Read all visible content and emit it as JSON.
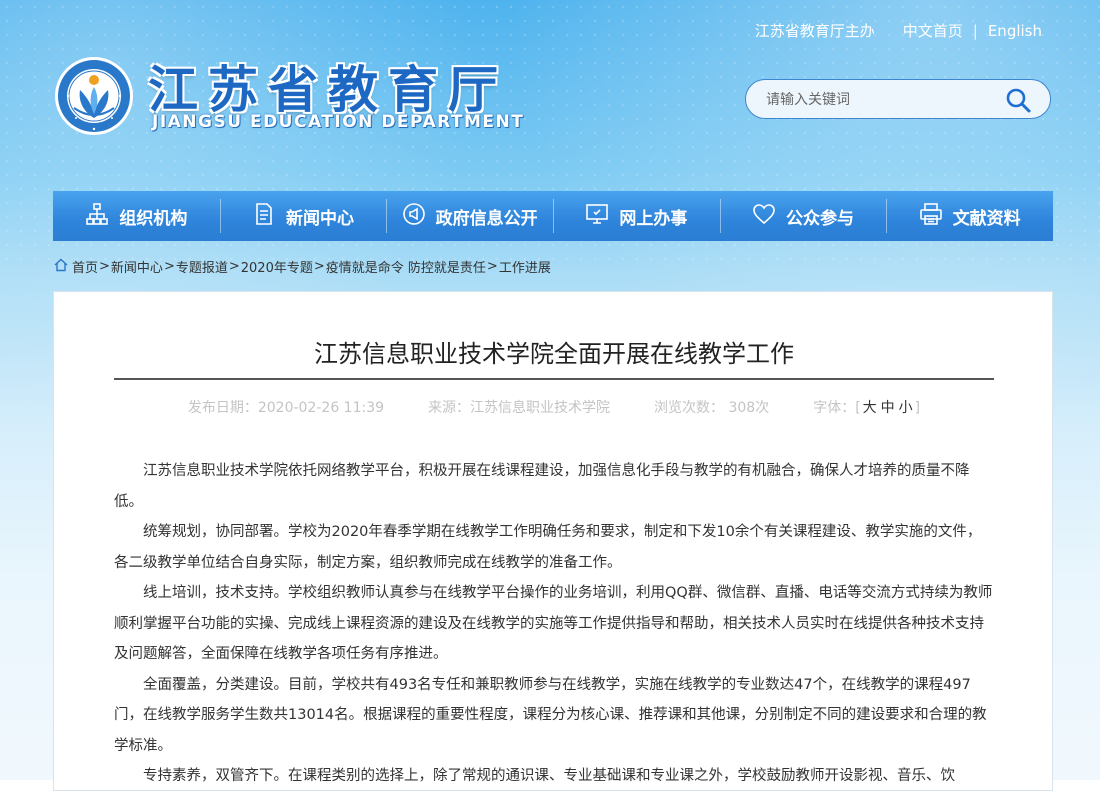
{
  "header": {
    "sponsor": "江苏省教育厅主办",
    "home_link": "中文首页",
    "separator": "|",
    "english_link": "English",
    "logo_cn": "江苏省教育厅",
    "logo_en": "JIANGSU EDUCATION DEPARTMENT"
  },
  "search": {
    "placeholder": "请输入关键词"
  },
  "nav": [
    {
      "label": "组织机构",
      "icon": "org-chart-icon"
    },
    {
      "label": "新闻中心",
      "icon": "document-icon"
    },
    {
      "label": "政府信息公开",
      "icon": "megaphone-icon"
    },
    {
      "label": "网上办事",
      "icon": "monitor-icon"
    },
    {
      "label": "公众参与",
      "icon": "heart-icon"
    },
    {
      "label": "文献资料",
      "icon": "printer-icon"
    }
  ],
  "breadcrumb": [
    "首页",
    "新闻中心",
    "专题报道",
    "2020年专题",
    "疫情就是命令 防控就是责任",
    "工作进展"
  ],
  "article": {
    "title": "江苏信息职业技术学院全面开展在线教学工作",
    "publish_date": "发布日期：2020-02-26 11:39",
    "source": "来源：江苏信息职业技术学院",
    "views": "浏览次数： 308次",
    "font_label": "字体：",
    "font_open": "[",
    "font_large": "大",
    "font_medium": "中",
    "font_small": "小",
    "font_close": "]",
    "paragraphs": [
      "江苏信息职业技术学院依托网络教学平台，积极开展在线课程建设，加强信息化手段与教学的有机融合，确保人才培养的质量不降低。",
      "统筹规划，协同部署。学校为2020年春季学期在线教学工作明确任务和要求，制定和下发10余个有关课程建设、教学实施的文件，各二级教学单位结合自身实际，制定方案，组织教师完成在线教学的准备工作。",
      "线上培训，技术支持。学校组织教师认真参与在线教学平台操作的业务培训，利用QQ群、微信群、直播、电话等交流方式持续为教师顺利掌握平台功能的实操、完成线上课程资源的建设及在线教学的实施等工作提供指导和帮助，相关技术人员实时在线提供各种技术支持及问题解答，全面保障在线教学各项任务有序推进。",
      "全面覆盖，分类建设。目前，学校共有493名专任和兼职教师参与在线教学，实施在线教学的专业数达47个，在线教学的课程497门，在线教学服务学生数共13014名。根据课程的重要性程度，课程分为核心课、推荐课和其他课，分别制定不同的建设要求和合理的教学标准。",
      "专持素养，双管齐下。在课程类别的选择上，除了常规的通识课、专业基础课和专业课之外，学校鼓励教师开设影视、音乐、饮"
    ]
  },
  "colors": {
    "nav_blue": "#2f86dc",
    "logo_blue": "#1d68c2",
    "search_border": "#3d86cf"
  }
}
